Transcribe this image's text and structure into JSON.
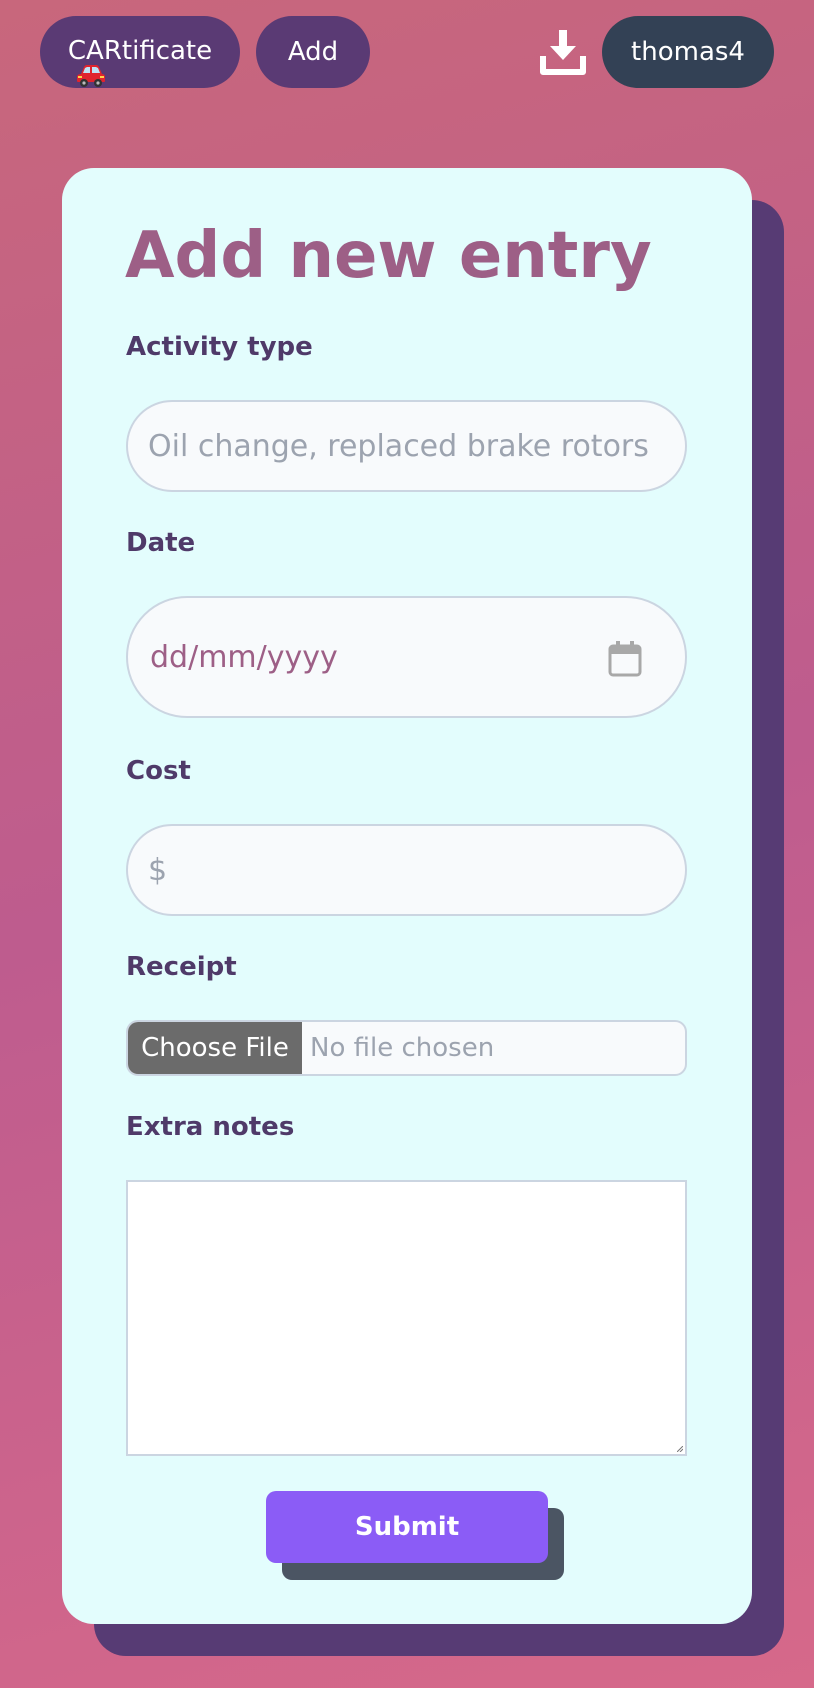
{
  "nav": {
    "brand_label": "CARtificate",
    "brand_emoji": "car-icon",
    "add_label": "Add",
    "download_icon": "download-icon",
    "user_label": "thomas4"
  },
  "form": {
    "title": "Add new entry",
    "activity": {
      "label": "Activity type",
      "placeholder": "Oil change, replaced brake rotors",
      "value": ""
    },
    "date": {
      "label": "Date",
      "placeholder": "dd/mm/yyyy",
      "icon": "calendar-icon"
    },
    "cost": {
      "label": "Cost",
      "placeholder": "$",
      "value": ""
    },
    "receipt": {
      "label": "Receipt",
      "button_label": "Choose File",
      "status": "No file chosen"
    },
    "notes": {
      "label": "Extra notes",
      "value": ""
    },
    "submit_label": "Submit"
  },
  "colors": {
    "nav_button": "#5a3a74",
    "user_button": "#334155",
    "card_background": "#e3fdfd",
    "card_shadow": "#573b74",
    "title": "#9d5f86",
    "label": "#4f3a69",
    "submit": "#8b5cf6",
    "submit_shadow": "#4b5563"
  }
}
